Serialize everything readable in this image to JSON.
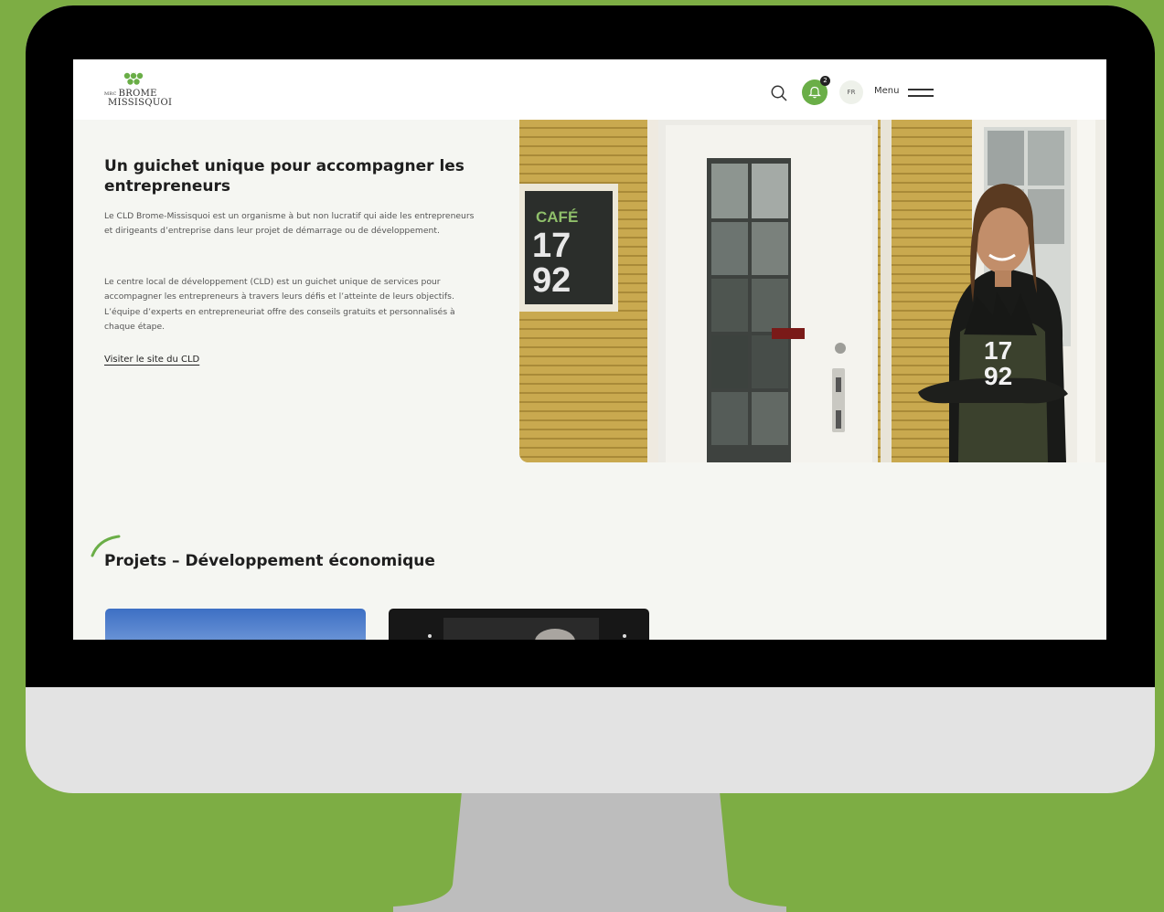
{
  "header": {
    "logo_prefix": "MRC",
    "logo_line1": "BROME",
    "logo_line2": "MISSISQUOI",
    "search_icon": "search-icon",
    "bell_icon": "bell-icon",
    "notification_count": "2",
    "language": "FR",
    "menu_label": "Menu",
    "menu_icon": "hamburger-icon"
  },
  "hero": {
    "title": "Un guichet unique pour accompagner les entrepreneurs",
    "paragraph1": "Le CLD Brome-Missisquoi est un organisme à but non lucratif qui aide les entrepreneurs et dirigeants d’entreprise dans leur projet de démarrage ou de développement.",
    "paragraph2": "Le centre local de développement (CLD) est un guichet unique de services pour accompagner les entrepreneurs à travers leurs défis et l’atteinte de leurs objectifs. L’équipe d’experts en entrepreneuriat offre des conseils gratuits et personnalisés à chaque étape.",
    "link": "Visiter le site du CLD",
    "image": {
      "sign_top": "CAFÉ",
      "sign_num1": "17",
      "sign_num2": "92",
      "apron_num1": "17",
      "apron_num2": "92"
    }
  },
  "projects": {
    "title": "Projets – Développement économique"
  },
  "colors": {
    "accent_green": "#6aae47",
    "background_green": "#7dad44",
    "page_bg": "#f5f6f2"
  }
}
